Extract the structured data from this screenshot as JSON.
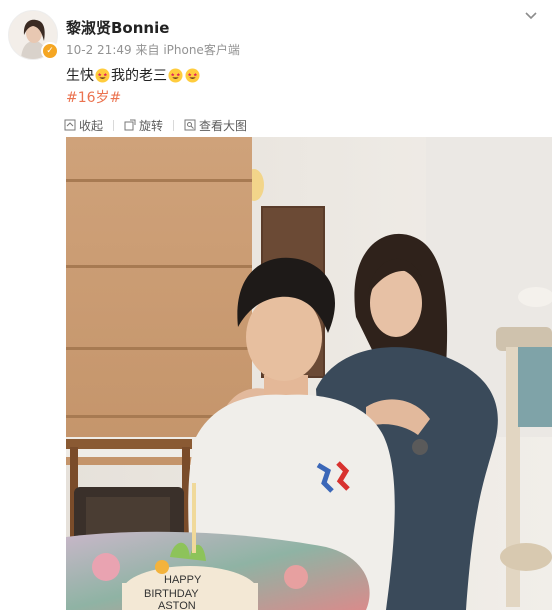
{
  "post": {
    "username": "黎淑贤Bonnie",
    "timestamp": "10-2 21:49",
    "source_prefix": "来自",
    "source": "iPhone客户端",
    "text_part1": "生快",
    "text_part2": "我的老三",
    "hashtag": "#16岁#",
    "icons": {
      "avatar": "avatar",
      "verified": "verified-badge-icon",
      "more": "chevron-down-icon",
      "emoji": "star-struck-emoji-icon"
    }
  },
  "toolbar": {
    "collapse_label": "收起",
    "rotate_label": "旋转",
    "view_large_label": "查看大图",
    "icons": [
      "collapse-icon",
      "rotate-icon",
      "view-large-icon"
    ]
  },
  "photo": {
    "cake_text_line1": "HAPPY",
    "cake_text_line2": "BIRTHDAY",
    "cake_text_line3": "ASTON"
  },
  "colors": {
    "hashtag": "#eb7350",
    "meta": "#939393",
    "text": "#222222",
    "badge": "#f5a623"
  }
}
